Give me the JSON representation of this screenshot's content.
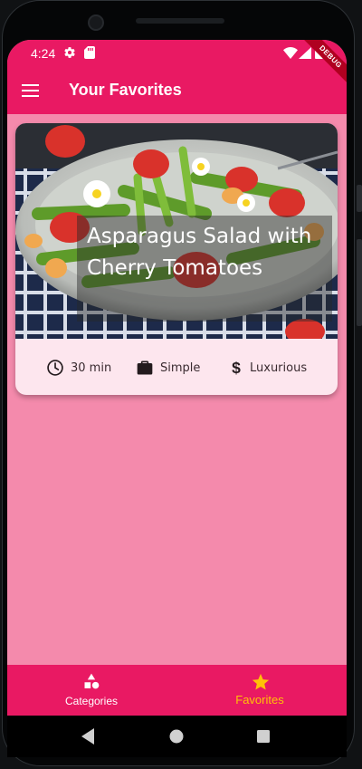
{
  "status_bar": {
    "time": "4:24",
    "icons": [
      "gear-icon",
      "sd-card-icon",
      "wifi-icon",
      "signal-icon",
      "battery-icon"
    ],
    "debug_banner": "DEBUG"
  },
  "app_bar": {
    "title": "Your Favorites",
    "menu_icon": "menu-icon",
    "color": "#e91963"
  },
  "favorites": [
    {
      "title": "Asparagus Salad with Cherry Tomatoes",
      "duration": "30 min",
      "complexity": "Simple",
      "affordability": "Luxurious",
      "image": "asparagus-salad-photo"
    }
  ],
  "bottom_nav": {
    "tabs": [
      {
        "label": "Categories",
        "icon": "category-shapes-icon",
        "selected": false
      },
      {
        "label": "Favorites",
        "icon": "star-icon",
        "selected": true
      }
    ],
    "selected_color": "#ffc107",
    "unselected_color": "#ffffff"
  },
  "colors": {
    "primary": "#e91963",
    "background": "#f48aac",
    "card": "#fde6ee",
    "accent": "#ffc107"
  }
}
